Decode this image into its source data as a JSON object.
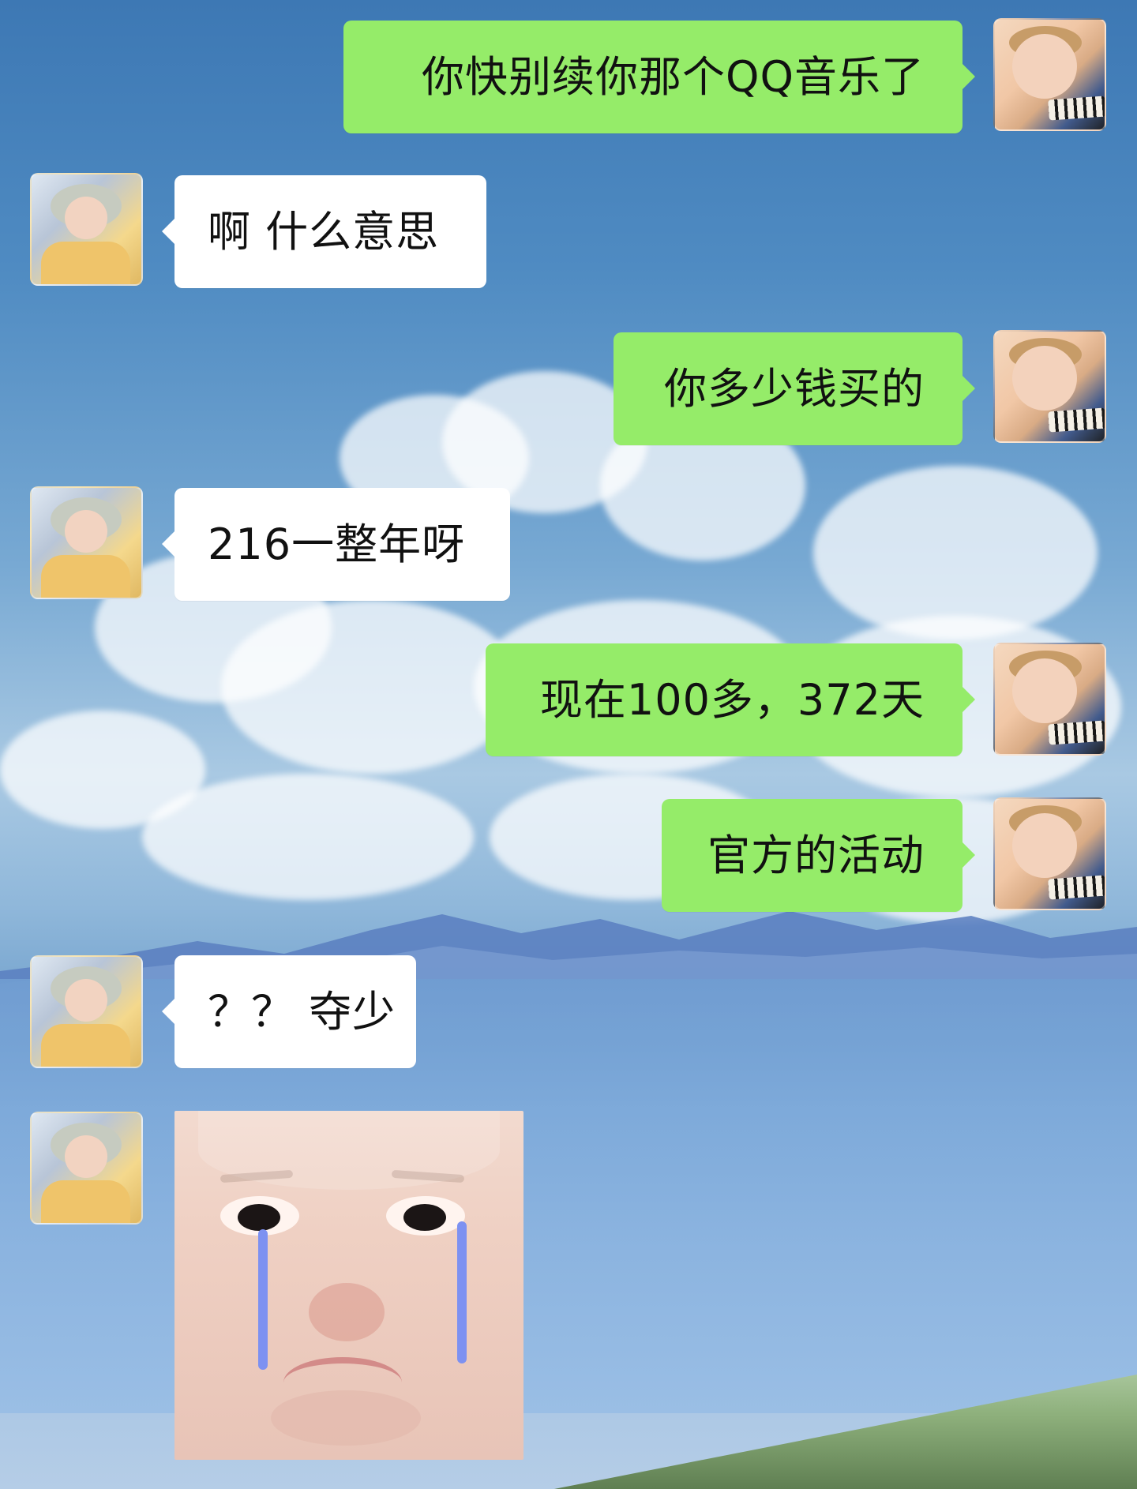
{
  "chat": {
    "messages": [
      {
        "side": "right",
        "type": "text",
        "text": "你快别续你那个QQ音乐了"
      },
      {
        "side": "left",
        "type": "text",
        "text": "啊 什么意思"
      },
      {
        "side": "right",
        "type": "text",
        "text": "你多少钱买的"
      },
      {
        "side": "left",
        "type": "text",
        "text": "216一整年呀"
      },
      {
        "side": "right",
        "type": "text",
        "text": "现在100多，372天"
      },
      {
        "side": "right",
        "type": "text",
        "text": "官方的活动"
      },
      {
        "side": "left",
        "type": "text",
        "text": "？？ 夺少"
      },
      {
        "side": "left",
        "type": "sticker",
        "sticker": "crying-baby-sticker"
      }
    ]
  },
  "colors": {
    "green_bubble": "#95ec69",
    "white_bubble": "#ffffff",
    "sky_top": "#3d78b4",
    "sky_bottom": "#b5cde7"
  },
  "icons": {
    "user_avatar": "sleeping-child-avatar-icon",
    "friend_avatar": "toddler-in-hat-avatar-icon"
  }
}
